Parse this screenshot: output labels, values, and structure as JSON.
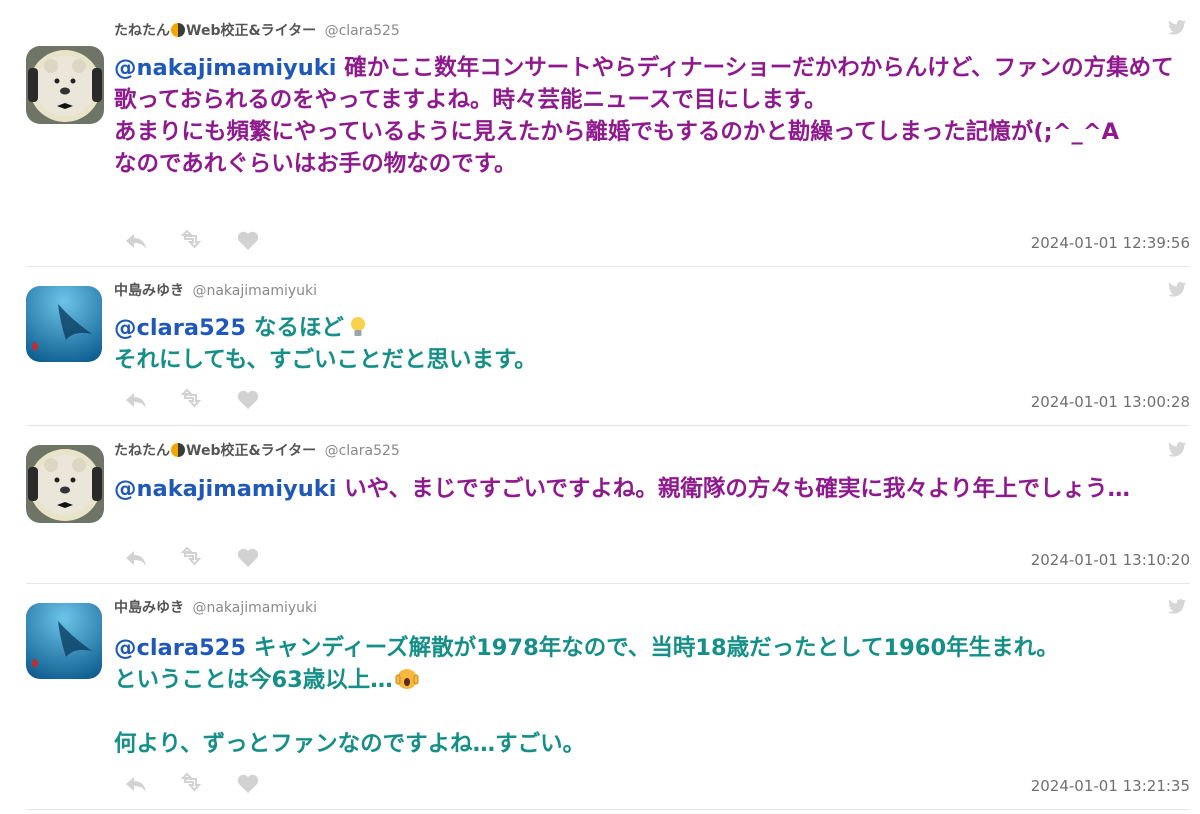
{
  "colors": {
    "purple_text": "#8e1a8e",
    "teal_text": "#168f88",
    "mention": "#1f58b7",
    "meta": "#8a8a8a",
    "icon": "#cfcfcf"
  },
  "tweets": [
    {
      "name_prefix": "たねたん",
      "name_suffix": "Web校正&ライター",
      "handle": "@clara525",
      "mention": "@nakajimamiyuki",
      "text": " 確かここ数年コンサートやらディナーショーだかわからんけど、ファンの方集めて歌っておられるのをやってますよね。時々芸能ニュースで目にします。\nあまりにも頻繁にやっているように見えたから離婚でもするのかと勘繰ってしまった記憶が(;^_^A\nなのであれぐらいはお手の物なのです。",
      "timestamp": "2024-01-01 12:39:56"
    },
    {
      "name": "中島みゆき",
      "handle": "@nakajimamiyuki",
      "mention": "@clara525",
      "text": " なるほど",
      "text2": "それにしても、すごいことだと思います。",
      "emoji": "lightbulb-emoji",
      "timestamp": "2024-01-01 13:00:28"
    },
    {
      "name_prefix": "たねたん",
      "name_suffix": "Web校正&ライター",
      "handle": "@clara525",
      "mention": "@nakajimamiyuki",
      "text": " いや、まじですごいですよね。親衛隊の方々も確実に我々より年上でしょう…",
      "timestamp": "2024-01-01 13:10:20"
    },
    {
      "name": "中島みゆき",
      "handle": "@nakajimamiyuki",
      "mention": "@clara525",
      "text": " キャンディーズ解散が1978年なので、当時18歳だったとして1960年生まれ。",
      "text2": "ということは今63歳以上…",
      "text3": "何より、ずっとファンなのですよね…すごい。",
      "emoji": "screaming-face-emoji",
      "timestamp": "2024-01-01 13:21:35"
    }
  ]
}
